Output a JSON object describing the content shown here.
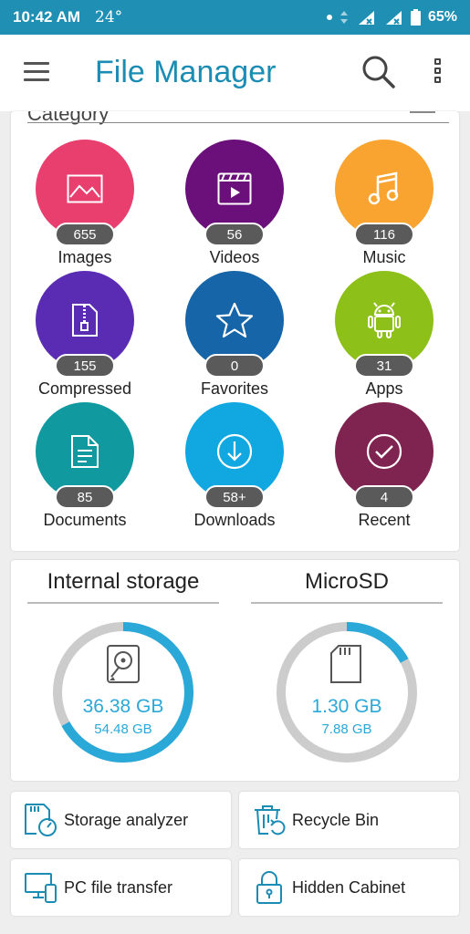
{
  "statusbar": {
    "time": "10:42 AM",
    "temp": "24°",
    "battery": "65%"
  },
  "appbar": {
    "title": "File Manager"
  },
  "category": {
    "header": "Category",
    "tiles": [
      {
        "label": "Images",
        "count": "655",
        "color": "#e83f6f",
        "icon": "image-icon"
      },
      {
        "label": "Videos",
        "count": "56",
        "color": "#6b0f7a",
        "icon": "video-icon"
      },
      {
        "label": "Music",
        "count": "116",
        "color": "#f9a431",
        "icon": "music-icon"
      },
      {
        "label": "Compressed",
        "count": "155",
        "color": "#5a2bb3",
        "icon": "zip-icon"
      },
      {
        "label": "Favorites",
        "count": "0",
        "color": "#1565a8",
        "icon": "star-icon"
      },
      {
        "label": "Apps",
        "count": "31",
        "color": "#8dc019",
        "icon": "android-icon"
      },
      {
        "label": "Documents",
        "count": "85",
        "color": "#109aa0",
        "icon": "document-icon"
      },
      {
        "label": "Downloads",
        "count": "58+",
        "color": "#11a8e2",
        "icon": "download-icon"
      },
      {
        "label": "Recent",
        "count": "4",
        "color": "#7f2350",
        "icon": "check-icon"
      }
    ]
  },
  "storage": {
    "internal": {
      "title": "Internal storage",
      "used": "36.38 GB",
      "total": "54.48 GB",
      "used_fraction": 0.67
    },
    "microsd": {
      "title": "MicroSD",
      "used": "1.30 GB",
      "total": "7.88 GB",
      "used_fraction": 0.17
    }
  },
  "tools": {
    "storage_analyzer": "Storage analyzer",
    "recycle_bin": "Recycle Bin",
    "pc_transfer": "PC file transfer",
    "hidden_cabinet": "Hidden Cabinet"
  },
  "colors": {
    "accent": "#1b8cb3",
    "statusbar": "#1f8fb4",
    "ring_used": "#2aa8d8",
    "ring_free": "#cccccc"
  }
}
